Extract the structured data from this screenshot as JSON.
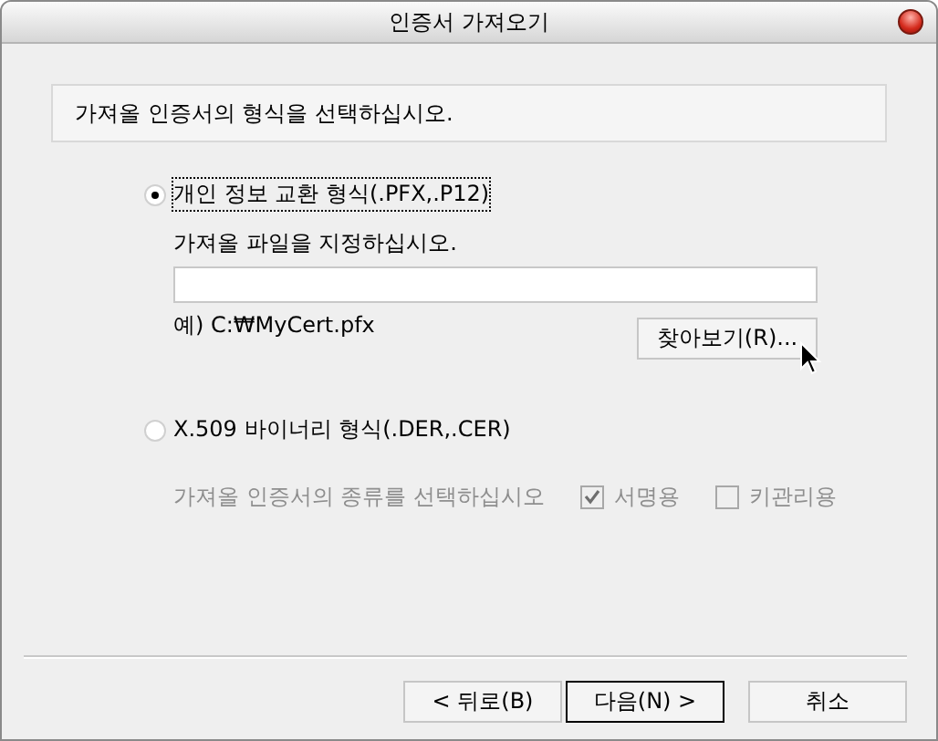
{
  "window": {
    "title": "인증서 가져오기"
  },
  "instruction": "가져올 인증서의 형식을 선택하십시오.",
  "formats": [
    {
      "kind": "pfx",
      "label": "개인 정보 교환 형식(.PFX,.P12)",
      "selected": true,
      "focused": true,
      "file_label": "가져올 파일을 지정하십시오.",
      "example": "예) C:₩MyCert.pfx",
      "browse_button": "찾아보기(R)..."
    },
    {
      "kind": "x509",
      "label": "X.509 바이너리 형식(.DER,.CER)",
      "selected": false,
      "focused": false,
      "usage_label": "가져올 인증서의 종류를 선택하십시오",
      "usages": [
        {
          "label": "서명용",
          "checked": true
        },
        {
          "label": "키관리용",
          "checked": false
        }
      ],
      "disabled": true
    }
  ],
  "buttons": [
    {
      "label": "< 뒤로(B)",
      "default": false
    },
    {
      "label": "다음(N) >",
      "default": true
    },
    {
      "label": "취소",
      "default": false
    }
  ]
}
